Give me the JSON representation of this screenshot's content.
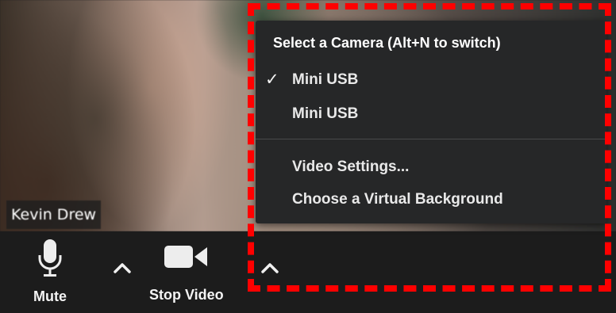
{
  "video": {
    "participant_name": "Kevin Drew"
  },
  "toolbar": {
    "mute_label": "Mute",
    "stop_video_label": "Stop Video"
  },
  "camera_menu": {
    "title": "Select a Camera (Alt+N to switch)",
    "cameras": [
      {
        "label": "Mini USB",
        "selected": true
      },
      {
        "label": "Mini USB",
        "selected": false
      }
    ],
    "selected_check": "✓",
    "options": [
      {
        "label": "Video Settings..."
      },
      {
        "label": "Choose a Virtual Background"
      }
    ]
  },
  "colors": {
    "highlight": "#ff0000",
    "menu_background": "#262728",
    "toolbar_background": "#1c1c1c"
  },
  "icons": [
    "microphone-icon",
    "caret-up-icon",
    "video-camera-icon",
    "check-icon"
  ]
}
